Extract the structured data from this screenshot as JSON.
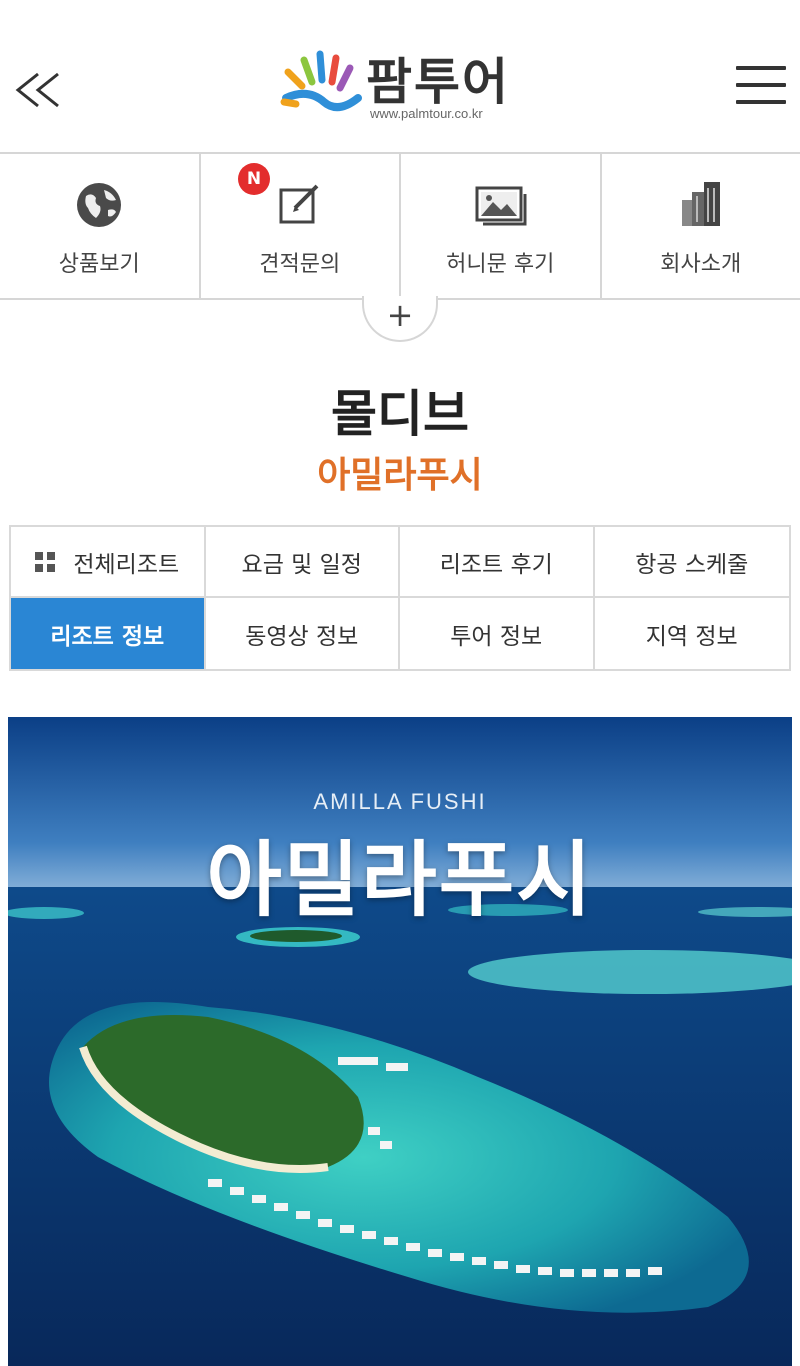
{
  "header": {
    "logo_text": "팜투어",
    "logo_url": "www.palmtour.co.kr",
    "back_icon": "double-chevron-left-icon",
    "menu_icon": "hamburger-menu-icon"
  },
  "quick_nav": {
    "items": [
      {
        "label": "상품보기",
        "icon": "globe-icon"
      },
      {
        "label": "견적문의",
        "icon": "edit-icon"
      },
      {
        "label": "허니문 후기",
        "icon": "image-icon"
      },
      {
        "label": "회사소개",
        "icon": "building-icon"
      }
    ],
    "new_badge": "N",
    "expand_label": "+"
  },
  "page": {
    "region": "몰디브",
    "resort": "아밀라푸시"
  },
  "tabs": [
    {
      "label": "전체리조트",
      "icon": "grid-icon",
      "active": false
    },
    {
      "label": "요금 및 일정",
      "active": false
    },
    {
      "label": "리조트 후기",
      "active": false
    },
    {
      "label": "항공 스케줄",
      "active": false
    },
    {
      "label": "리조트 정보",
      "active": true
    },
    {
      "label": "동영상 정보",
      "active": false
    },
    {
      "label": "투어 정보",
      "active": false
    },
    {
      "label": "지역 정보",
      "active": false
    }
  ],
  "hero": {
    "title_en": "AMILLA FUSHI",
    "title_ko": "아밀라푸시"
  },
  "colors": {
    "accent_orange": "#e07028",
    "active_tab_blue": "#2a86d4",
    "badge_red": "#e32d2d"
  }
}
